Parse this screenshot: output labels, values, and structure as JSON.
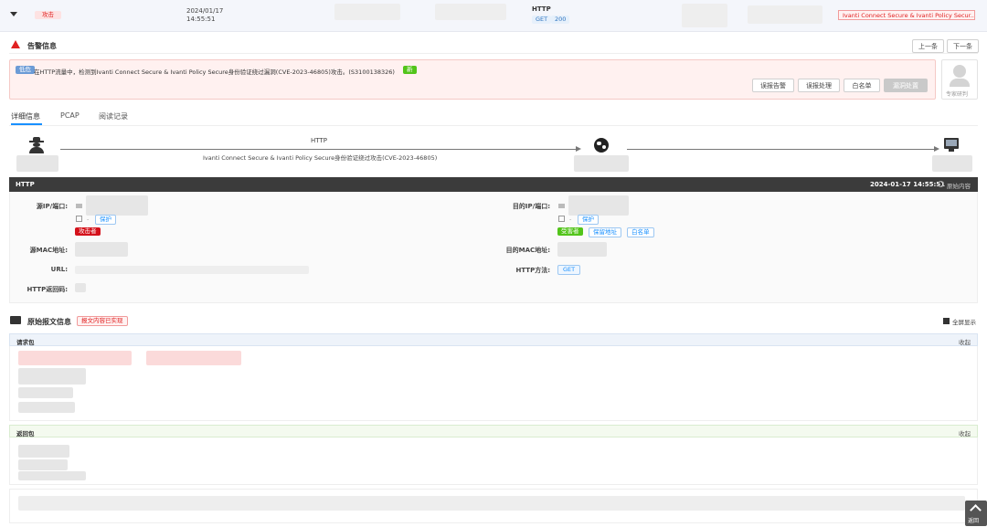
{
  "top_row": {
    "tag": "攻击",
    "date": "2024/01/17",
    "time": "14:55:51",
    "protocol": "HTTP",
    "method": "GET",
    "status_code": "200",
    "rule": "Ivanti Connect Secure & Ivanti Policy Secur..."
  },
  "alert": {
    "title": "告警信息",
    "prev": "上一条",
    "next": "下一条",
    "badge": "低危",
    "message": "在HTTP流量中，检测到Ivanti Connect Secure & Ivanti Policy Secure身份验证绕过漏洞(CVE-2023-46805)攻击。(S3100138326)",
    "new_badge": "新",
    "actions": [
      "误报告警",
      "误报处理",
      "白名单",
      "漏洞处置"
    ],
    "expert": "专家研判"
  },
  "tabs": [
    "详细信息",
    "PCAP",
    "阅读记录"
  ],
  "flow": {
    "protocol": "HTTP",
    "description": "Ivanti Connect Secure & Ivanti Policy Secure身份验证绕过攻击(CVE-2023-46805)"
  },
  "detail": {
    "header": "HTTP",
    "timestamp": "2024-01-17 14:55:51",
    "raw_link": "原始内容",
    "src_label": "源IP/端口:",
    "dst_label": "目的IP/端口:",
    "src_mac_label": "源MAC地址:",
    "dst_mac_label": "目的MAC地址:",
    "url_label": "URL:",
    "method_label": "HTTP方法:",
    "method_value": "GET",
    "status_label": "HTTP返回码:",
    "attacker": "攻击者",
    "victim": "受害者",
    "src_protect": "保护",
    "dst_protect": "保护",
    "dst_assoc": "保留地址",
    "whitelist": "白名单",
    "dash": "-"
  },
  "raw": {
    "title": "原始报文信息",
    "note": "报文内容已实现",
    "fullscreen": "全屏显示",
    "request": "请求包",
    "response": "返回包",
    "collapse": "收起",
    "back_top": "返回"
  },
  "colors": {
    "red": "#e02020",
    "green": "#52c41a",
    "blue": "#1890ff",
    "dark_header": "#3b3b3b"
  }
}
